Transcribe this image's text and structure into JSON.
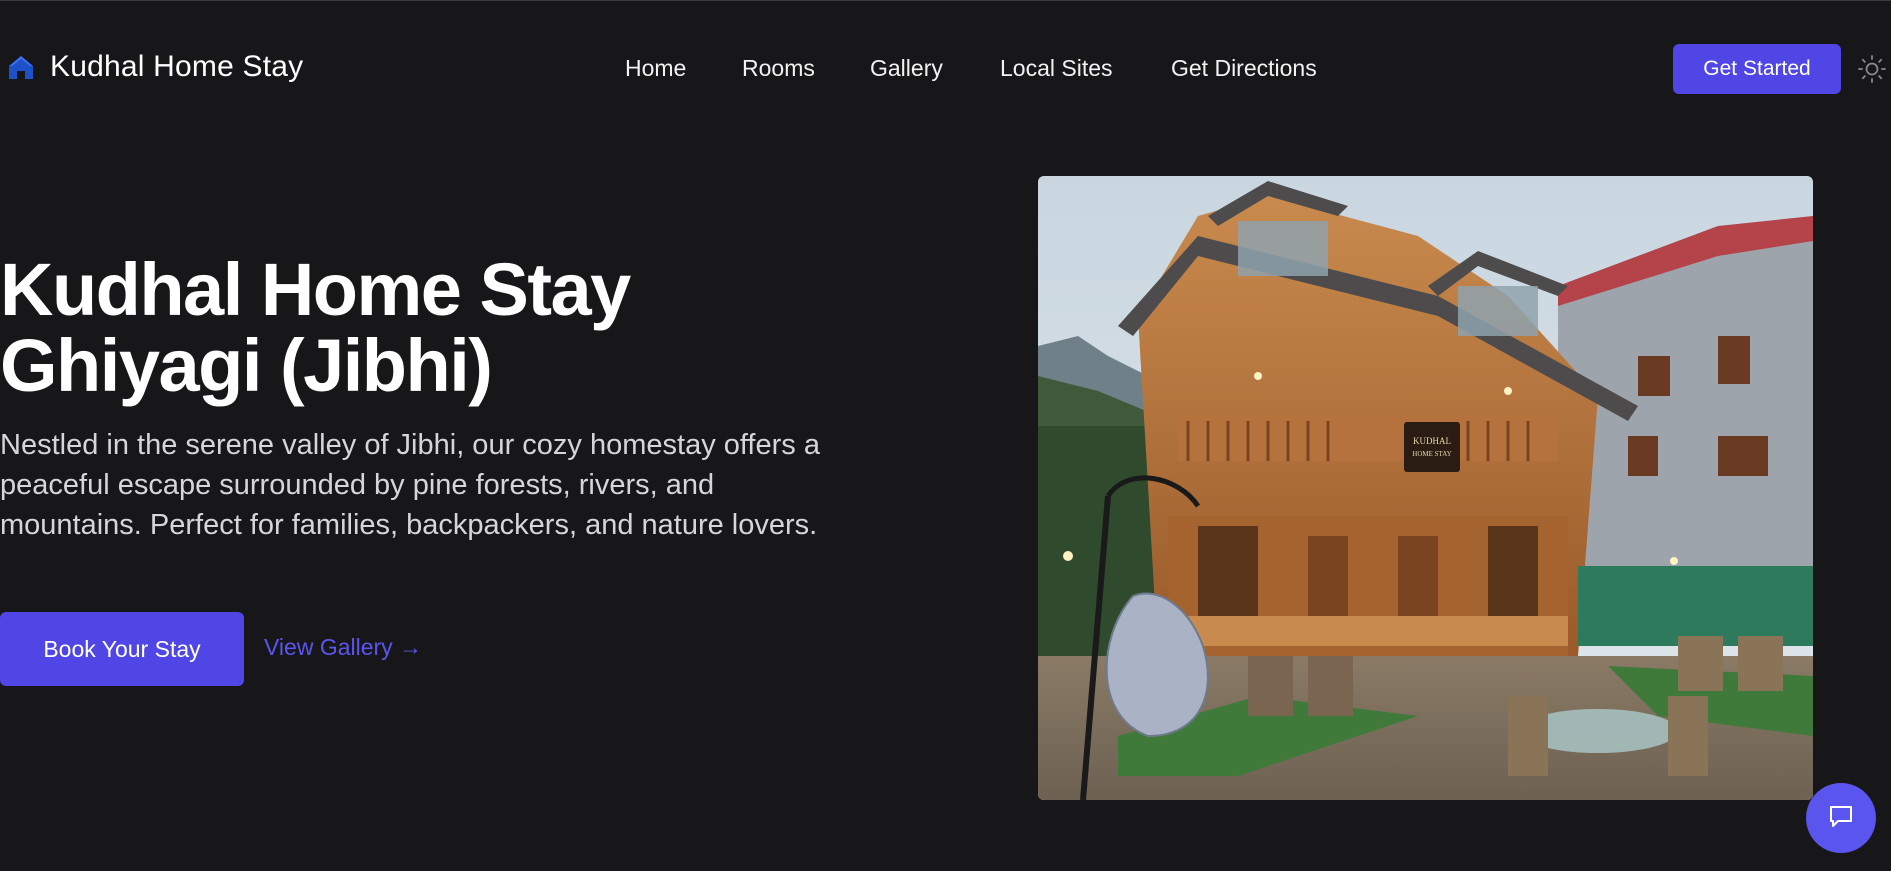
{
  "header": {
    "brand_name": "Kudhal Home Stay",
    "brand_icon": "home-icon",
    "nav": [
      {
        "label": "Home"
      },
      {
        "label": "Rooms"
      },
      {
        "label": "Gallery"
      },
      {
        "label": "Local Sites"
      },
      {
        "label": "Get Directions"
      }
    ],
    "cta_label": "Get Started",
    "theme_icon": "sun-icon"
  },
  "hero": {
    "title_line1": "Kudhal Home Stay",
    "title_line2": "Ghiyagi (Jibhi)",
    "description": "Nestled in the serene valley of Jibhi, our cozy homestay offers a peaceful escape surrounded by pine forests, rivers, and mountains. Perfect for families, backpackers, and nature lovers.",
    "primary_button": "Book Your Stay",
    "secondary_link": "View Gallery →",
    "image_sign_text": "KUDHAL HOME STAY"
  },
  "chat": {
    "icon": "chat-bubble-icon"
  },
  "colors": {
    "background": "#171618",
    "accent": "#4f46e5",
    "link": "#5b55f0",
    "text": "#ffffff",
    "muted_text": "#d6d6d9"
  }
}
